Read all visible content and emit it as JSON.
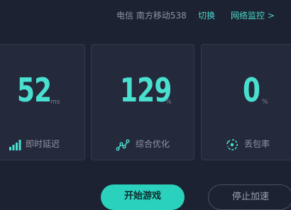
{
  "header": {
    "isp_label": "电信  南方移动538",
    "switch_label": "切换",
    "monitor_label": "网络监控 >"
  },
  "metrics": [
    {
      "value": "52",
      "unit": "ms",
      "label": "即时延迟",
      "icon": "signal-bars-icon"
    },
    {
      "value": "129",
      "unit": "%",
      "label": "综合优化",
      "icon": "trend-line-icon"
    },
    {
      "value": "0",
      "unit": "%",
      "label": "丢包率",
      "icon": "packet-loss-icon"
    }
  ],
  "actions": {
    "start_label": "开始游戏",
    "stop_label": "停止加速"
  },
  "colors": {
    "background": "#1d2232",
    "card": "#242a3b",
    "accent": "#49e0d0",
    "button": "#2ad1bd"
  }
}
